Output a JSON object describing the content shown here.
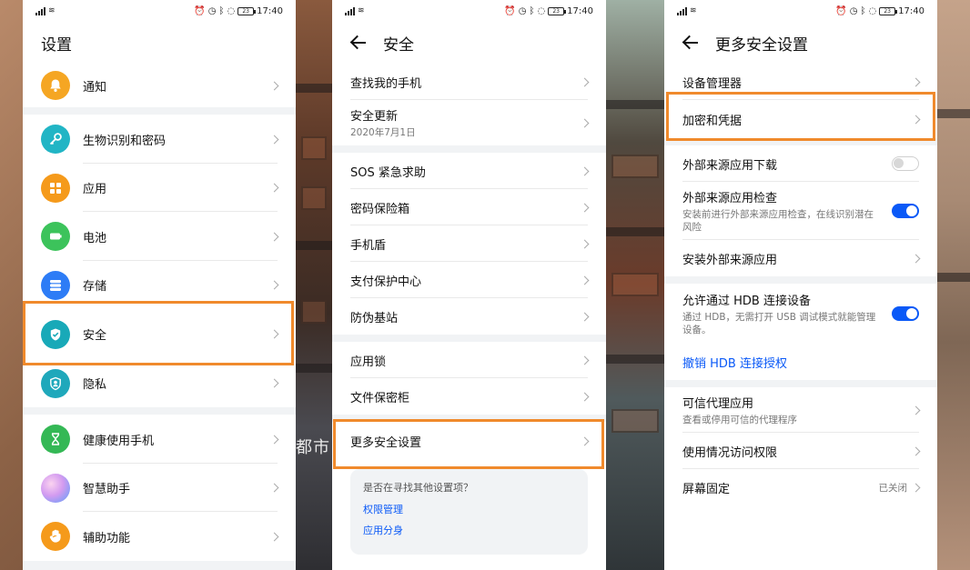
{
  "status": {
    "time": "17:40",
    "battery": "23",
    "icons_left": [
      "signal-icon",
      "wifi-icon"
    ],
    "icons_right": [
      "alarm-icon",
      "clock-icon",
      "bluetooth-icon",
      "nfc-icon",
      "battery-icon"
    ]
  },
  "background": {
    "overlay_text": "都市"
  },
  "screen1": {
    "title": "设置",
    "items": [
      {
        "label": "通知",
        "icon": "bell-icon",
        "color": "#f5a623"
      },
      {
        "label": "生物识别和密码",
        "icon": "key-icon",
        "color": "#21b5c5"
      },
      {
        "label": "应用",
        "icon": "apps-grid-icon",
        "color": "#f59a1b"
      },
      {
        "label": "电池",
        "icon": "battery-icon",
        "color": "#3cc35b"
      },
      {
        "label": "存储",
        "icon": "storage-icon",
        "color": "#2d7cf6"
      },
      {
        "label": "安全",
        "icon": "shield-check-icon",
        "color": "#18a9b8"
      },
      {
        "label": "隐私",
        "icon": "privacy-icon",
        "color": "#1fa8bb"
      },
      {
        "label": "健康使用手机",
        "icon": "hourglass-icon",
        "color": "#34b855"
      },
      {
        "label": "智慧助手",
        "icon": "assistant-orb-icon",
        "color": "#c08be8"
      },
      {
        "label": "辅助功能",
        "icon": "hand-icon",
        "color": "#f59a1b"
      }
    ]
  },
  "screen2": {
    "title": "安全",
    "items": [
      {
        "label": "查找我的手机"
      },
      {
        "label": "安全更新",
        "sub": "2020年7月1日"
      },
      {
        "label": "SOS 紧急求助"
      },
      {
        "label": "密码保险箱"
      },
      {
        "label": "手机盾"
      },
      {
        "label": "支付保护中心"
      },
      {
        "label": "防伪基站"
      },
      {
        "label": "应用锁"
      },
      {
        "label": "文件保密柜"
      },
      {
        "label": "更多安全设置"
      }
    ],
    "suggest": {
      "question": "是否在寻找其他设置项？",
      "links": [
        "权限管理",
        "应用分身"
      ]
    }
  },
  "screen3": {
    "title": "更多安全设置",
    "items": [
      {
        "label": "设备管理器"
      },
      {
        "label": "加密和凭据"
      },
      {
        "label": "外部来源应用下载",
        "toggle": "off"
      },
      {
        "label": "外部来源应用检查",
        "sub": "安装前进行外部来源应用检查，在线识别潜在风险",
        "toggle": "on"
      },
      {
        "label": "安装外部来源应用"
      },
      {
        "label": "允许通过 HDB 连接设备",
        "sub": "通过 HDB，无需打开 USB 调试模式就能管理设备。",
        "toggle": "on"
      },
      {
        "label": "撤销 HDB 连接授权"
      },
      {
        "label": "可信代理应用",
        "sub": "查看或停用可信的代理程序"
      },
      {
        "label": "使用情况访问权限"
      },
      {
        "label": "屏幕固定",
        "state": "已关闭"
      }
    ]
  },
  "highlight_color": "#f08a2c"
}
